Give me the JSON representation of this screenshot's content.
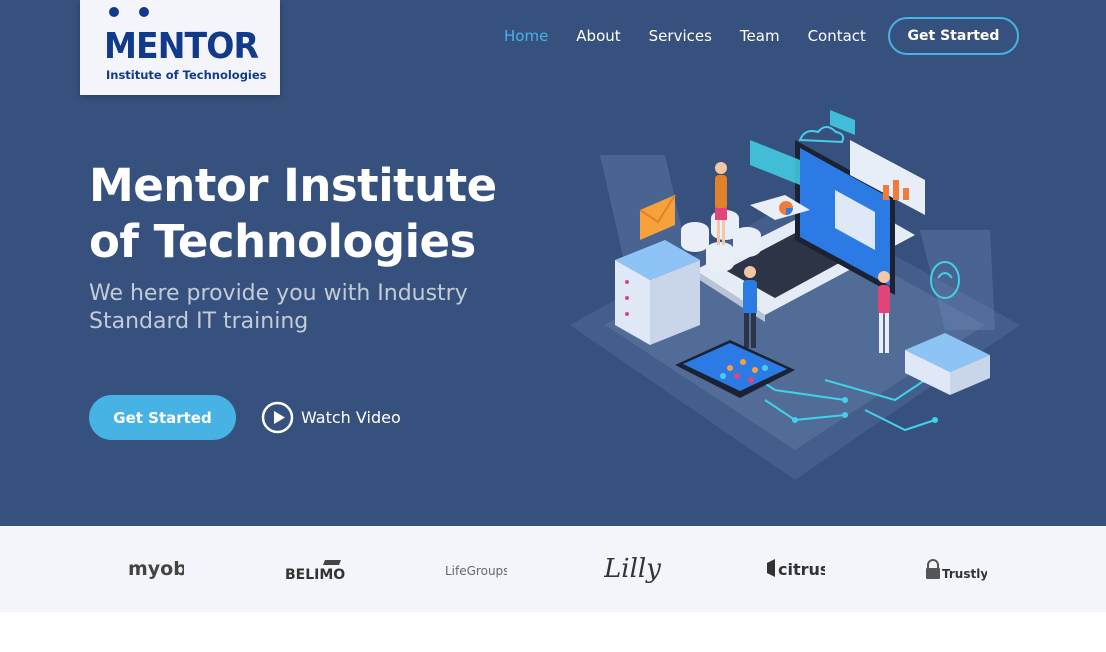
{
  "brand": {
    "logo_word": "MENTOR",
    "logo_sub": "Institute of Technologies"
  },
  "nav": {
    "items": [
      {
        "label": "Home",
        "active": true
      },
      {
        "label": "About",
        "active": false
      },
      {
        "label": "Services",
        "active": false
      },
      {
        "label": "Team",
        "active": false
      },
      {
        "label": "Contact",
        "active": false
      }
    ],
    "cta_label": "Get Started"
  },
  "hero": {
    "title": "Mentor Institute of Technologies",
    "subtitle": "We here provide you with Industry Standard IT training",
    "primary_button": "Get Started",
    "video_button": "Watch Video"
  },
  "clients": {
    "logos": [
      {
        "name": "myob",
        "icon": "myob-logo"
      },
      {
        "name": "BELIMO",
        "icon": "belimo-logo"
      },
      {
        "name": "LifeGroups",
        "icon": "lifegroups-logo"
      },
      {
        "name": "Lilly",
        "icon": "lilly-logo"
      },
      {
        "name": "citrus",
        "icon": "citrus-logo"
      },
      {
        "name": "Trustly",
        "icon": "trustly-logo"
      }
    ]
  },
  "colors": {
    "hero_bg": "#37517e",
    "accent": "#47b2e4",
    "logo_blue": "#123a8a",
    "clients_bg": "#f3f5fa"
  }
}
